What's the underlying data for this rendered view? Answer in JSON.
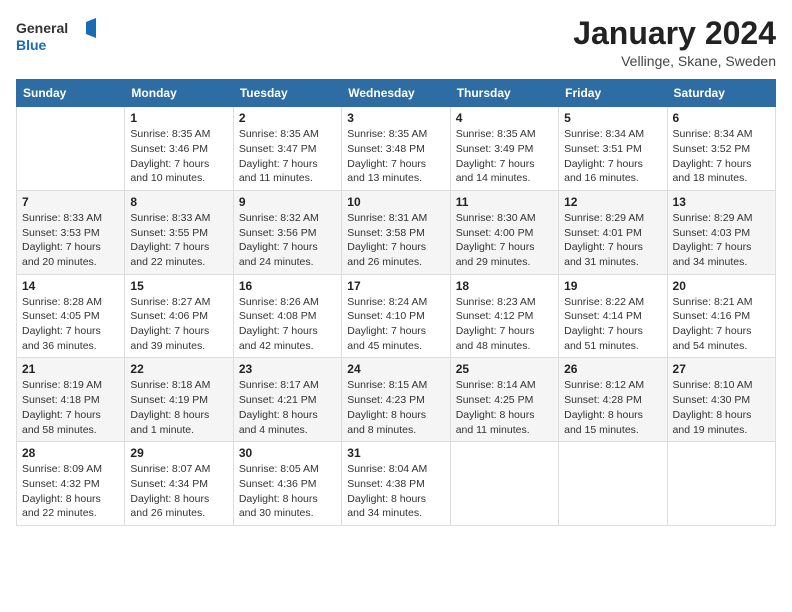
{
  "header": {
    "logo_general": "General",
    "logo_blue": "Blue",
    "title": "January 2024",
    "location": "Vellinge, Skane, Sweden"
  },
  "weekdays": [
    "Sunday",
    "Monday",
    "Tuesday",
    "Wednesday",
    "Thursday",
    "Friday",
    "Saturday"
  ],
  "weeks": [
    [
      {
        "day": "",
        "info": ""
      },
      {
        "day": "1",
        "info": "Sunrise: 8:35 AM\nSunset: 3:46 PM\nDaylight: 7 hours\nand 10 minutes."
      },
      {
        "day": "2",
        "info": "Sunrise: 8:35 AM\nSunset: 3:47 PM\nDaylight: 7 hours\nand 11 minutes."
      },
      {
        "day": "3",
        "info": "Sunrise: 8:35 AM\nSunset: 3:48 PM\nDaylight: 7 hours\nand 13 minutes."
      },
      {
        "day": "4",
        "info": "Sunrise: 8:35 AM\nSunset: 3:49 PM\nDaylight: 7 hours\nand 14 minutes."
      },
      {
        "day": "5",
        "info": "Sunrise: 8:34 AM\nSunset: 3:51 PM\nDaylight: 7 hours\nand 16 minutes."
      },
      {
        "day": "6",
        "info": "Sunrise: 8:34 AM\nSunset: 3:52 PM\nDaylight: 7 hours\nand 18 minutes."
      }
    ],
    [
      {
        "day": "7",
        "info": "Sunrise: 8:33 AM\nSunset: 3:53 PM\nDaylight: 7 hours\nand 20 minutes."
      },
      {
        "day": "8",
        "info": "Sunrise: 8:33 AM\nSunset: 3:55 PM\nDaylight: 7 hours\nand 22 minutes."
      },
      {
        "day": "9",
        "info": "Sunrise: 8:32 AM\nSunset: 3:56 PM\nDaylight: 7 hours\nand 24 minutes."
      },
      {
        "day": "10",
        "info": "Sunrise: 8:31 AM\nSunset: 3:58 PM\nDaylight: 7 hours\nand 26 minutes."
      },
      {
        "day": "11",
        "info": "Sunrise: 8:30 AM\nSunset: 4:00 PM\nDaylight: 7 hours\nand 29 minutes."
      },
      {
        "day": "12",
        "info": "Sunrise: 8:29 AM\nSunset: 4:01 PM\nDaylight: 7 hours\nand 31 minutes."
      },
      {
        "day": "13",
        "info": "Sunrise: 8:29 AM\nSunset: 4:03 PM\nDaylight: 7 hours\nand 34 minutes."
      }
    ],
    [
      {
        "day": "14",
        "info": "Sunrise: 8:28 AM\nSunset: 4:05 PM\nDaylight: 7 hours\nand 36 minutes."
      },
      {
        "day": "15",
        "info": "Sunrise: 8:27 AM\nSunset: 4:06 PM\nDaylight: 7 hours\nand 39 minutes."
      },
      {
        "day": "16",
        "info": "Sunrise: 8:26 AM\nSunset: 4:08 PM\nDaylight: 7 hours\nand 42 minutes."
      },
      {
        "day": "17",
        "info": "Sunrise: 8:24 AM\nSunset: 4:10 PM\nDaylight: 7 hours\nand 45 minutes."
      },
      {
        "day": "18",
        "info": "Sunrise: 8:23 AM\nSunset: 4:12 PM\nDaylight: 7 hours\nand 48 minutes."
      },
      {
        "day": "19",
        "info": "Sunrise: 8:22 AM\nSunset: 4:14 PM\nDaylight: 7 hours\nand 51 minutes."
      },
      {
        "day": "20",
        "info": "Sunrise: 8:21 AM\nSunset: 4:16 PM\nDaylight: 7 hours\nand 54 minutes."
      }
    ],
    [
      {
        "day": "21",
        "info": "Sunrise: 8:19 AM\nSunset: 4:18 PM\nDaylight: 7 hours\nand 58 minutes."
      },
      {
        "day": "22",
        "info": "Sunrise: 8:18 AM\nSunset: 4:19 PM\nDaylight: 8 hours\nand 1 minute."
      },
      {
        "day": "23",
        "info": "Sunrise: 8:17 AM\nSunset: 4:21 PM\nDaylight: 8 hours\nand 4 minutes."
      },
      {
        "day": "24",
        "info": "Sunrise: 8:15 AM\nSunset: 4:23 PM\nDaylight: 8 hours\nand 8 minutes."
      },
      {
        "day": "25",
        "info": "Sunrise: 8:14 AM\nSunset: 4:25 PM\nDaylight: 8 hours\nand 11 minutes."
      },
      {
        "day": "26",
        "info": "Sunrise: 8:12 AM\nSunset: 4:28 PM\nDaylight: 8 hours\nand 15 minutes."
      },
      {
        "day": "27",
        "info": "Sunrise: 8:10 AM\nSunset: 4:30 PM\nDaylight: 8 hours\nand 19 minutes."
      }
    ],
    [
      {
        "day": "28",
        "info": "Sunrise: 8:09 AM\nSunset: 4:32 PM\nDaylight: 8 hours\nand 22 minutes."
      },
      {
        "day": "29",
        "info": "Sunrise: 8:07 AM\nSunset: 4:34 PM\nDaylight: 8 hours\nand 26 minutes."
      },
      {
        "day": "30",
        "info": "Sunrise: 8:05 AM\nSunset: 4:36 PM\nDaylight: 8 hours\nand 30 minutes."
      },
      {
        "day": "31",
        "info": "Sunrise: 8:04 AM\nSunset: 4:38 PM\nDaylight: 8 hours\nand 34 minutes."
      },
      {
        "day": "",
        "info": ""
      },
      {
        "day": "",
        "info": ""
      },
      {
        "day": "",
        "info": ""
      }
    ]
  ]
}
